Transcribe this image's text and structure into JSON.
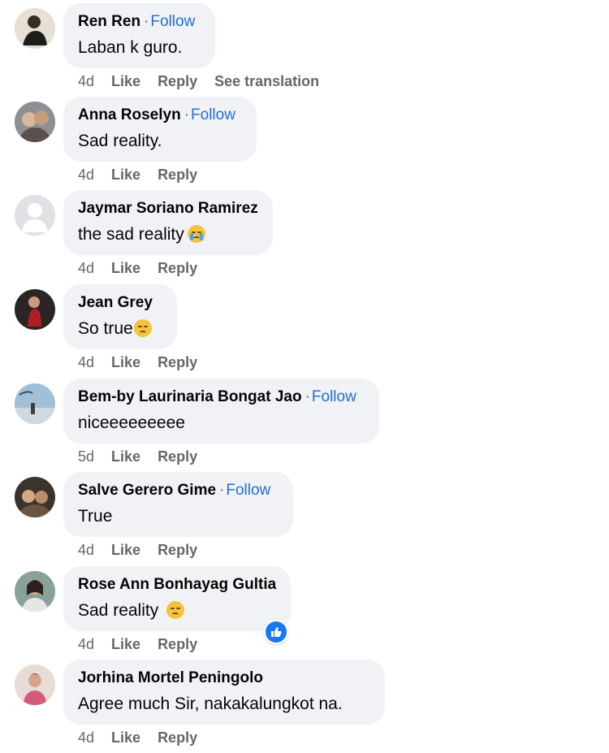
{
  "comments": [
    {
      "author": "Ren Ren",
      "follow": "Follow",
      "text": "Laban k guro.",
      "emoji": "",
      "time": "4d",
      "like": "Like",
      "reply": "Reply",
      "translation": "See translation"
    },
    {
      "author": "Anna Roselyn",
      "follow": "Follow",
      "text": "Sad reality.",
      "emoji": "",
      "time": "4d",
      "like": "Like",
      "reply": "Reply"
    },
    {
      "author": "Jaymar Soriano Ramirez",
      "follow": "",
      "text": "the sad reality",
      "emoji": "crying-face",
      "time": "4d",
      "like": "Like",
      "reply": "Reply"
    },
    {
      "author": "Jean Grey",
      "follow": "",
      "text": "So true",
      "emoji": "pensive-face",
      "time": "4d",
      "like": "Like",
      "reply": "Reply"
    },
    {
      "author": "Bem-by Laurinaria Bongat Jao",
      "follow": "Follow",
      "text": "niceeeeeeeee",
      "emoji": "",
      "time": "5d",
      "like": "Like",
      "reply": "Reply"
    },
    {
      "author": "Salve Gerero Gime",
      "follow": "Follow",
      "text": "True",
      "emoji": "",
      "time": "4d",
      "like": "Like",
      "reply": "Reply"
    },
    {
      "author": "Rose Ann Bonhayag Gultia",
      "follow": "",
      "text": "Sad reality",
      "emoji": "pensive-face",
      "time": "4d",
      "like": "Like",
      "reply": "Reply",
      "reaction": "like-icon"
    },
    {
      "author": "Jorhina Mortel Peningolo",
      "follow": "",
      "text": "Agree much Sir, nakakalungkot na.",
      "emoji": "",
      "time": "4d",
      "like": "Like",
      "reply": "Reply"
    }
  ],
  "colors": {
    "bubble": "#f0f2f5",
    "follow": "#216fdb",
    "meta": "#65676b",
    "like_badge": "#1877f2"
  }
}
